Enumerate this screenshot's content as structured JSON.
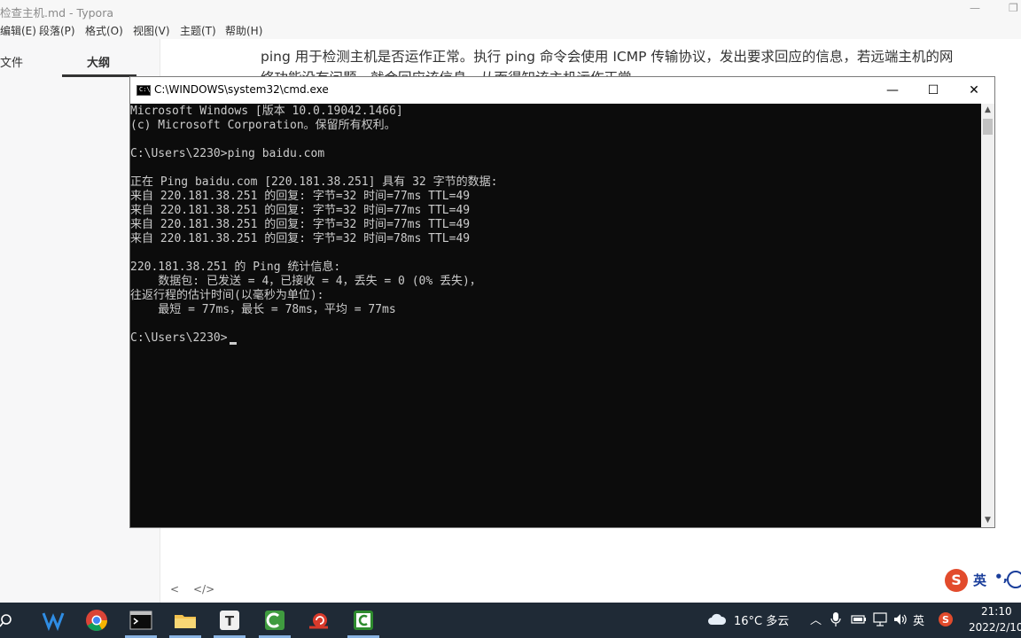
{
  "typora": {
    "window_title": "检查主机.md - Typora",
    "menu": [
      "编辑(E)",
      "段落(P)",
      "格式(O)",
      "视图(V)",
      "主题(T)",
      "帮助(H)"
    ],
    "sidebar_tabs": [
      "文件",
      "大纲"
    ],
    "content_line1": "ping 用于检测主机是否运作正常。执行 ping 命令会使用 ICMP 传输协议，发出要求回应的信息，若远端主机的网",
    "content_line2": "络功能没有问题，就会回应该信息，从而得知该主机运作正常。",
    "footer_back": "<",
    "footer_source": "</>"
  },
  "cmd": {
    "title": "C:\\WINDOWS\\system32\\cmd.exe",
    "icon_label": "C:\\",
    "lines": [
      "Microsoft Windows [版本 10.0.19042.1466]",
      "(c) Microsoft Corporation。保留所有权利。",
      "",
      "C:\\Users\\2230>ping baidu.com",
      "",
      "正在 Ping baidu.com [220.181.38.251] 具有 32 字节的数据:",
      "来自 220.181.38.251 的回复: 字节=32 时间=77ms TTL=49",
      "来自 220.181.38.251 的回复: 字节=32 时间=77ms TTL=49",
      "来自 220.181.38.251 的回复: 字节=32 时间=77ms TTL=49",
      "来自 220.181.38.251 的回复: 字节=32 时间=78ms TTL=49",
      "",
      "220.181.38.251 的 Ping 统计信息:",
      "    数据包: 已发送 = 4，已接收 = 4，丢失 = 0 (0% 丢失)，",
      "往返行程的估计时间(以毫秒为单位):",
      "    最短 = 77ms，最长 = 78ms，平均 = 77ms",
      "",
      "C:\\Users\\2230>"
    ]
  },
  "ime": {
    "logo": "S",
    "lang": "英",
    "punct": "•,"
  },
  "taskbar": {
    "weather": "16°C 多云",
    "lang": "英",
    "time": "21:10",
    "date": "2022/2/10"
  },
  "colors": {
    "taskbar_bg": "#1f2a36",
    "console_bg": "#0c0c0c",
    "console_fg": "#cccccc"
  }
}
